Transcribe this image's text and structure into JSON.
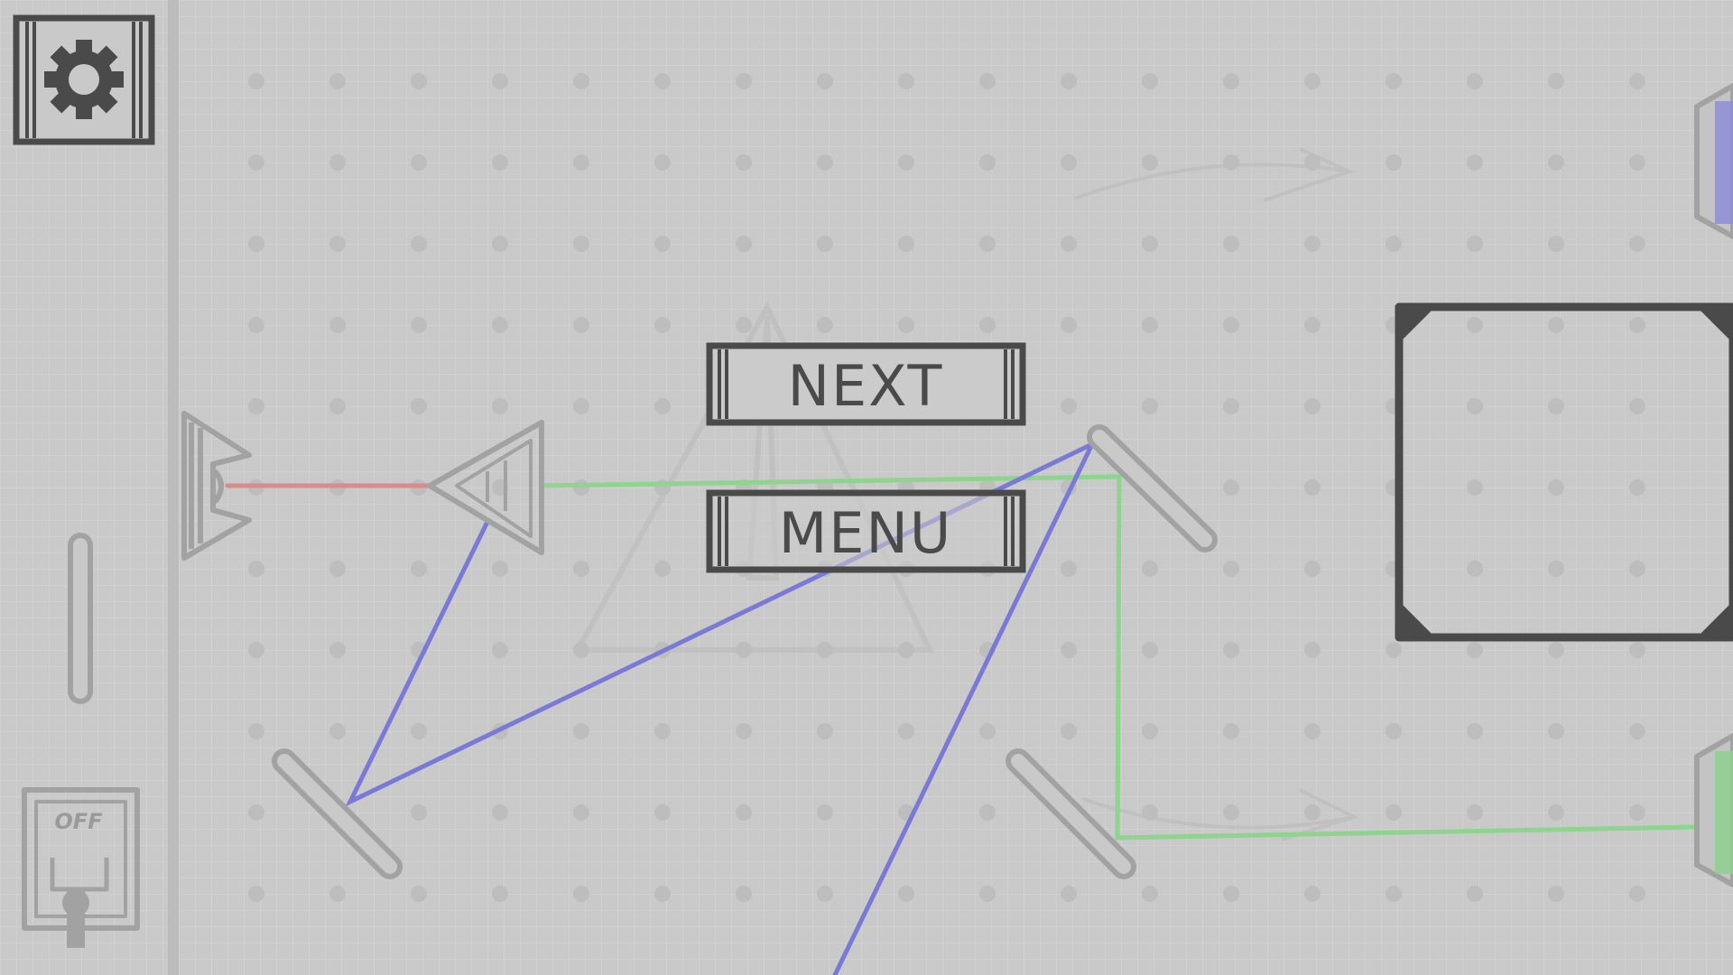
{
  "buttons": {
    "next_label": "NEXT",
    "menu_label": "MENU"
  },
  "power_switch": {
    "state_label": "OFF"
  },
  "icons": {
    "settings": "gear-icon"
  },
  "colors": {
    "background": "#c9c9c9",
    "ui_dark": "#4a4a4a",
    "red_beam": "#d98a8a",
    "green_beam": "#8ed48e",
    "blue_beam": "#7a7ad6"
  }
}
